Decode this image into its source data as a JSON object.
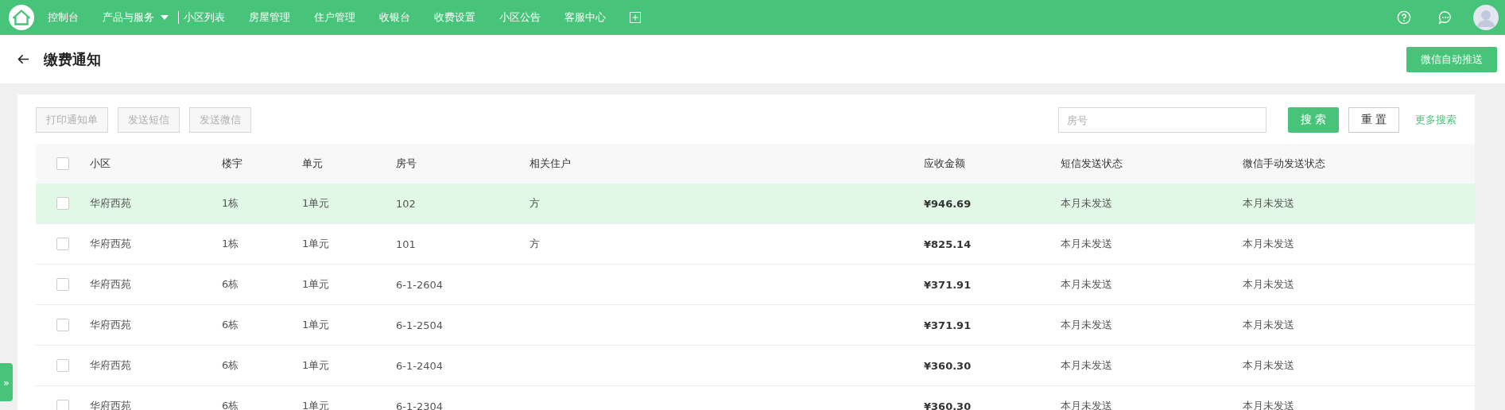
{
  "nav": {
    "items": [
      {
        "label": "控制台",
        "kind": "link"
      },
      {
        "label": "产品与服务",
        "kind": "dropdown"
      },
      {
        "label": "小区列表",
        "kind": "divided"
      },
      {
        "label": "房屋管理",
        "kind": "link"
      },
      {
        "label": "住户管理",
        "kind": "link"
      },
      {
        "label": "收银台",
        "kind": "link"
      },
      {
        "label": "收费设置",
        "kind": "link"
      },
      {
        "label": "小区公告",
        "kind": "link"
      },
      {
        "label": "客服中心",
        "kind": "link"
      }
    ]
  },
  "page": {
    "title": "缴费通知",
    "action": "微信自动推送"
  },
  "toolbar": {
    "buttons": [
      {
        "label": "打印通知单",
        "disabled": true
      },
      {
        "label": "发送短信",
        "disabled": true
      },
      {
        "label": "发送微信",
        "disabled": true
      }
    ],
    "search": {
      "placeholder": "房号"
    },
    "search_button": "搜 索",
    "reset_button": "重 置",
    "more_link": "更多搜索"
  },
  "table": {
    "select_all_checked": false,
    "columns": [
      "小区",
      "楼宇",
      "单元",
      "房号",
      "相关住户",
      "应收金额",
      "短信发送状态",
      "微信手动发送状态"
    ],
    "rows": [
      {
        "selected": true,
        "checked": false,
        "cells": [
          "华府西苑",
          "1栋",
          "1单元",
          "102",
          "方",
          "¥946.69",
          "本月未发送",
          "本月未发送"
        ]
      },
      {
        "selected": false,
        "checked": false,
        "cells": [
          "华府西苑",
          "1栋",
          "1单元",
          "101",
          "方",
          "¥825.14",
          "本月未发送",
          "本月未发送"
        ]
      },
      {
        "selected": false,
        "checked": false,
        "cells": [
          "华府西苑",
          "6栋",
          "1单元",
          "6-1-2604",
          "",
          "¥371.91",
          "本月未发送",
          "本月未发送"
        ]
      },
      {
        "selected": false,
        "checked": false,
        "cells": [
          "华府西苑",
          "6栋",
          "1单元",
          "6-1-2504",
          "",
          "¥371.91",
          "本月未发送",
          "本月未发送"
        ]
      },
      {
        "selected": false,
        "checked": false,
        "cells": [
          "华府西苑",
          "6栋",
          "1单元",
          "6-1-2404",
          "",
          "¥360.30",
          "本月未发送",
          "本月未发送"
        ]
      },
      {
        "selected": false,
        "checked": false,
        "cells": [
          "华府西苑",
          "6栋",
          "1单元",
          "6-1-2304",
          "",
          "¥360.30",
          "本月未发送",
          "本月未发送"
        ]
      }
    ]
  },
  "side_tab": "»"
}
